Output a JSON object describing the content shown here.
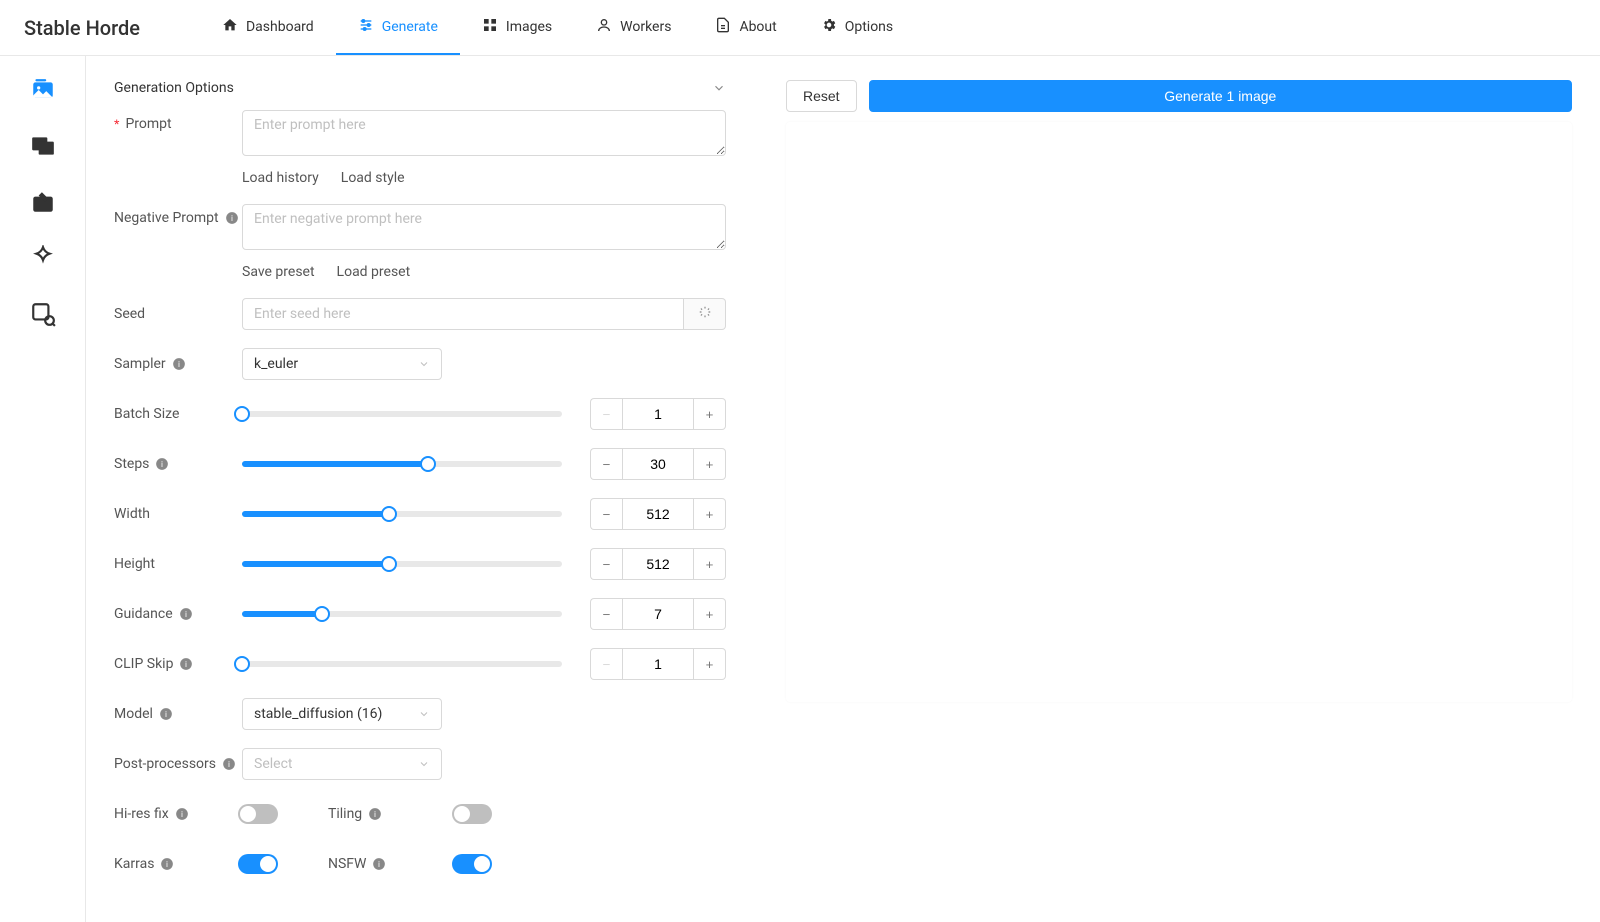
{
  "brand": "Stable Horde",
  "nav": {
    "dashboard": "Dashboard",
    "generate": "Generate",
    "images": "Images",
    "workers": "Workers",
    "about": "About",
    "options": "Options"
  },
  "section": {
    "title": "Generation Options"
  },
  "labels": {
    "prompt": "Prompt",
    "negative": "Negative Prompt",
    "seed": "Seed",
    "sampler": "Sampler",
    "batch": "Batch Size",
    "steps": "Steps",
    "width": "Width",
    "height": "Height",
    "guidance": "Guidance",
    "clipskip": "CLIP Skip",
    "model": "Model",
    "postproc": "Post-processors",
    "hires": "Hi-res fix",
    "tiling": "Tiling",
    "karras": "Karras",
    "nsfw": "NSFW"
  },
  "placeholders": {
    "prompt": "Enter prompt here",
    "negative": "Enter negative prompt here",
    "seed": "Enter seed here",
    "postproc": "Select"
  },
  "sublinks": {
    "load_history": "Load history",
    "load_style": "Load style",
    "save_preset": "Save preset",
    "load_preset": "Load preset"
  },
  "values": {
    "sampler": "k_euler",
    "batch": "1",
    "steps": "30",
    "width": "512",
    "height": "512",
    "guidance": "7",
    "clipskip": "1",
    "model": "stable_diffusion (16)"
  },
  "slider_pct": {
    "batch": 0,
    "steps": 58,
    "width": 46,
    "height": 46,
    "guidance": 25,
    "clipskip": 0
  },
  "toggles": {
    "hires": false,
    "tiling": false,
    "karras": true,
    "nsfw": true
  },
  "actions": {
    "reset": "Reset",
    "generate": "Generate 1 image"
  }
}
